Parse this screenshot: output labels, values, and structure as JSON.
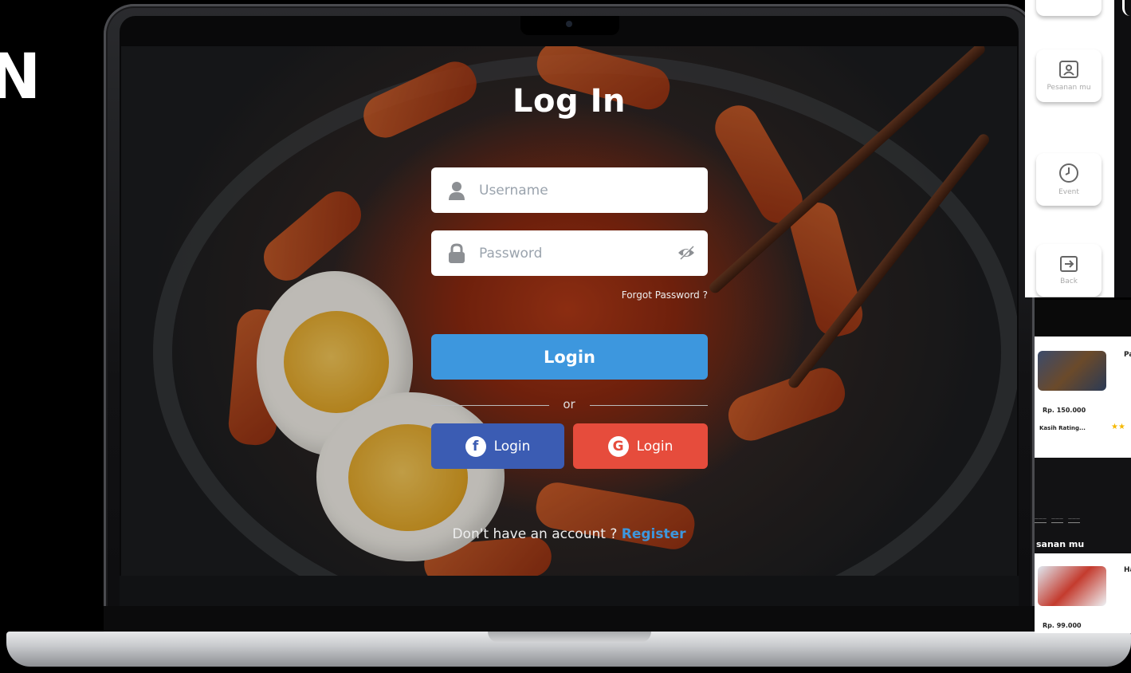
{
  "background_heading": {
    "visible_fragment": "N"
  },
  "login_screen": {
    "title": "Log In",
    "username": {
      "placeholder": "Username",
      "value": ""
    },
    "password": {
      "placeholder": "Password",
      "value": ""
    },
    "forgot_password": "Forgot Password ?",
    "login_button": "Login",
    "divider_text": "or",
    "facebook_button": "Login",
    "google_button": "Login",
    "no_account_text": "Don't have an account ?",
    "register_link": "Register"
  },
  "side_nav": {
    "items": [
      {
        "label": "Pesanan mu",
        "icon": "person-card-icon"
      },
      {
        "label": "Event",
        "icon": "clock-icon"
      },
      {
        "label": "Back",
        "icon": "exit-icon"
      }
    ]
  },
  "app_preview": {
    "cards": [
      {
        "price": "Rp. 150.000",
        "label": "Kasih Rating..."
      },
      {
        "price": "Rp. 99.000"
      }
    ],
    "section_title": "sanan mu",
    "first_card_title_fragment": "Pa",
    "second_card_title_fragment": "Ha"
  },
  "colors": {
    "primary_blue": "#3d97de",
    "facebook_blue": "#3b5cb3",
    "google_red": "#e64c3c",
    "star_yellow": "#f5b800"
  }
}
